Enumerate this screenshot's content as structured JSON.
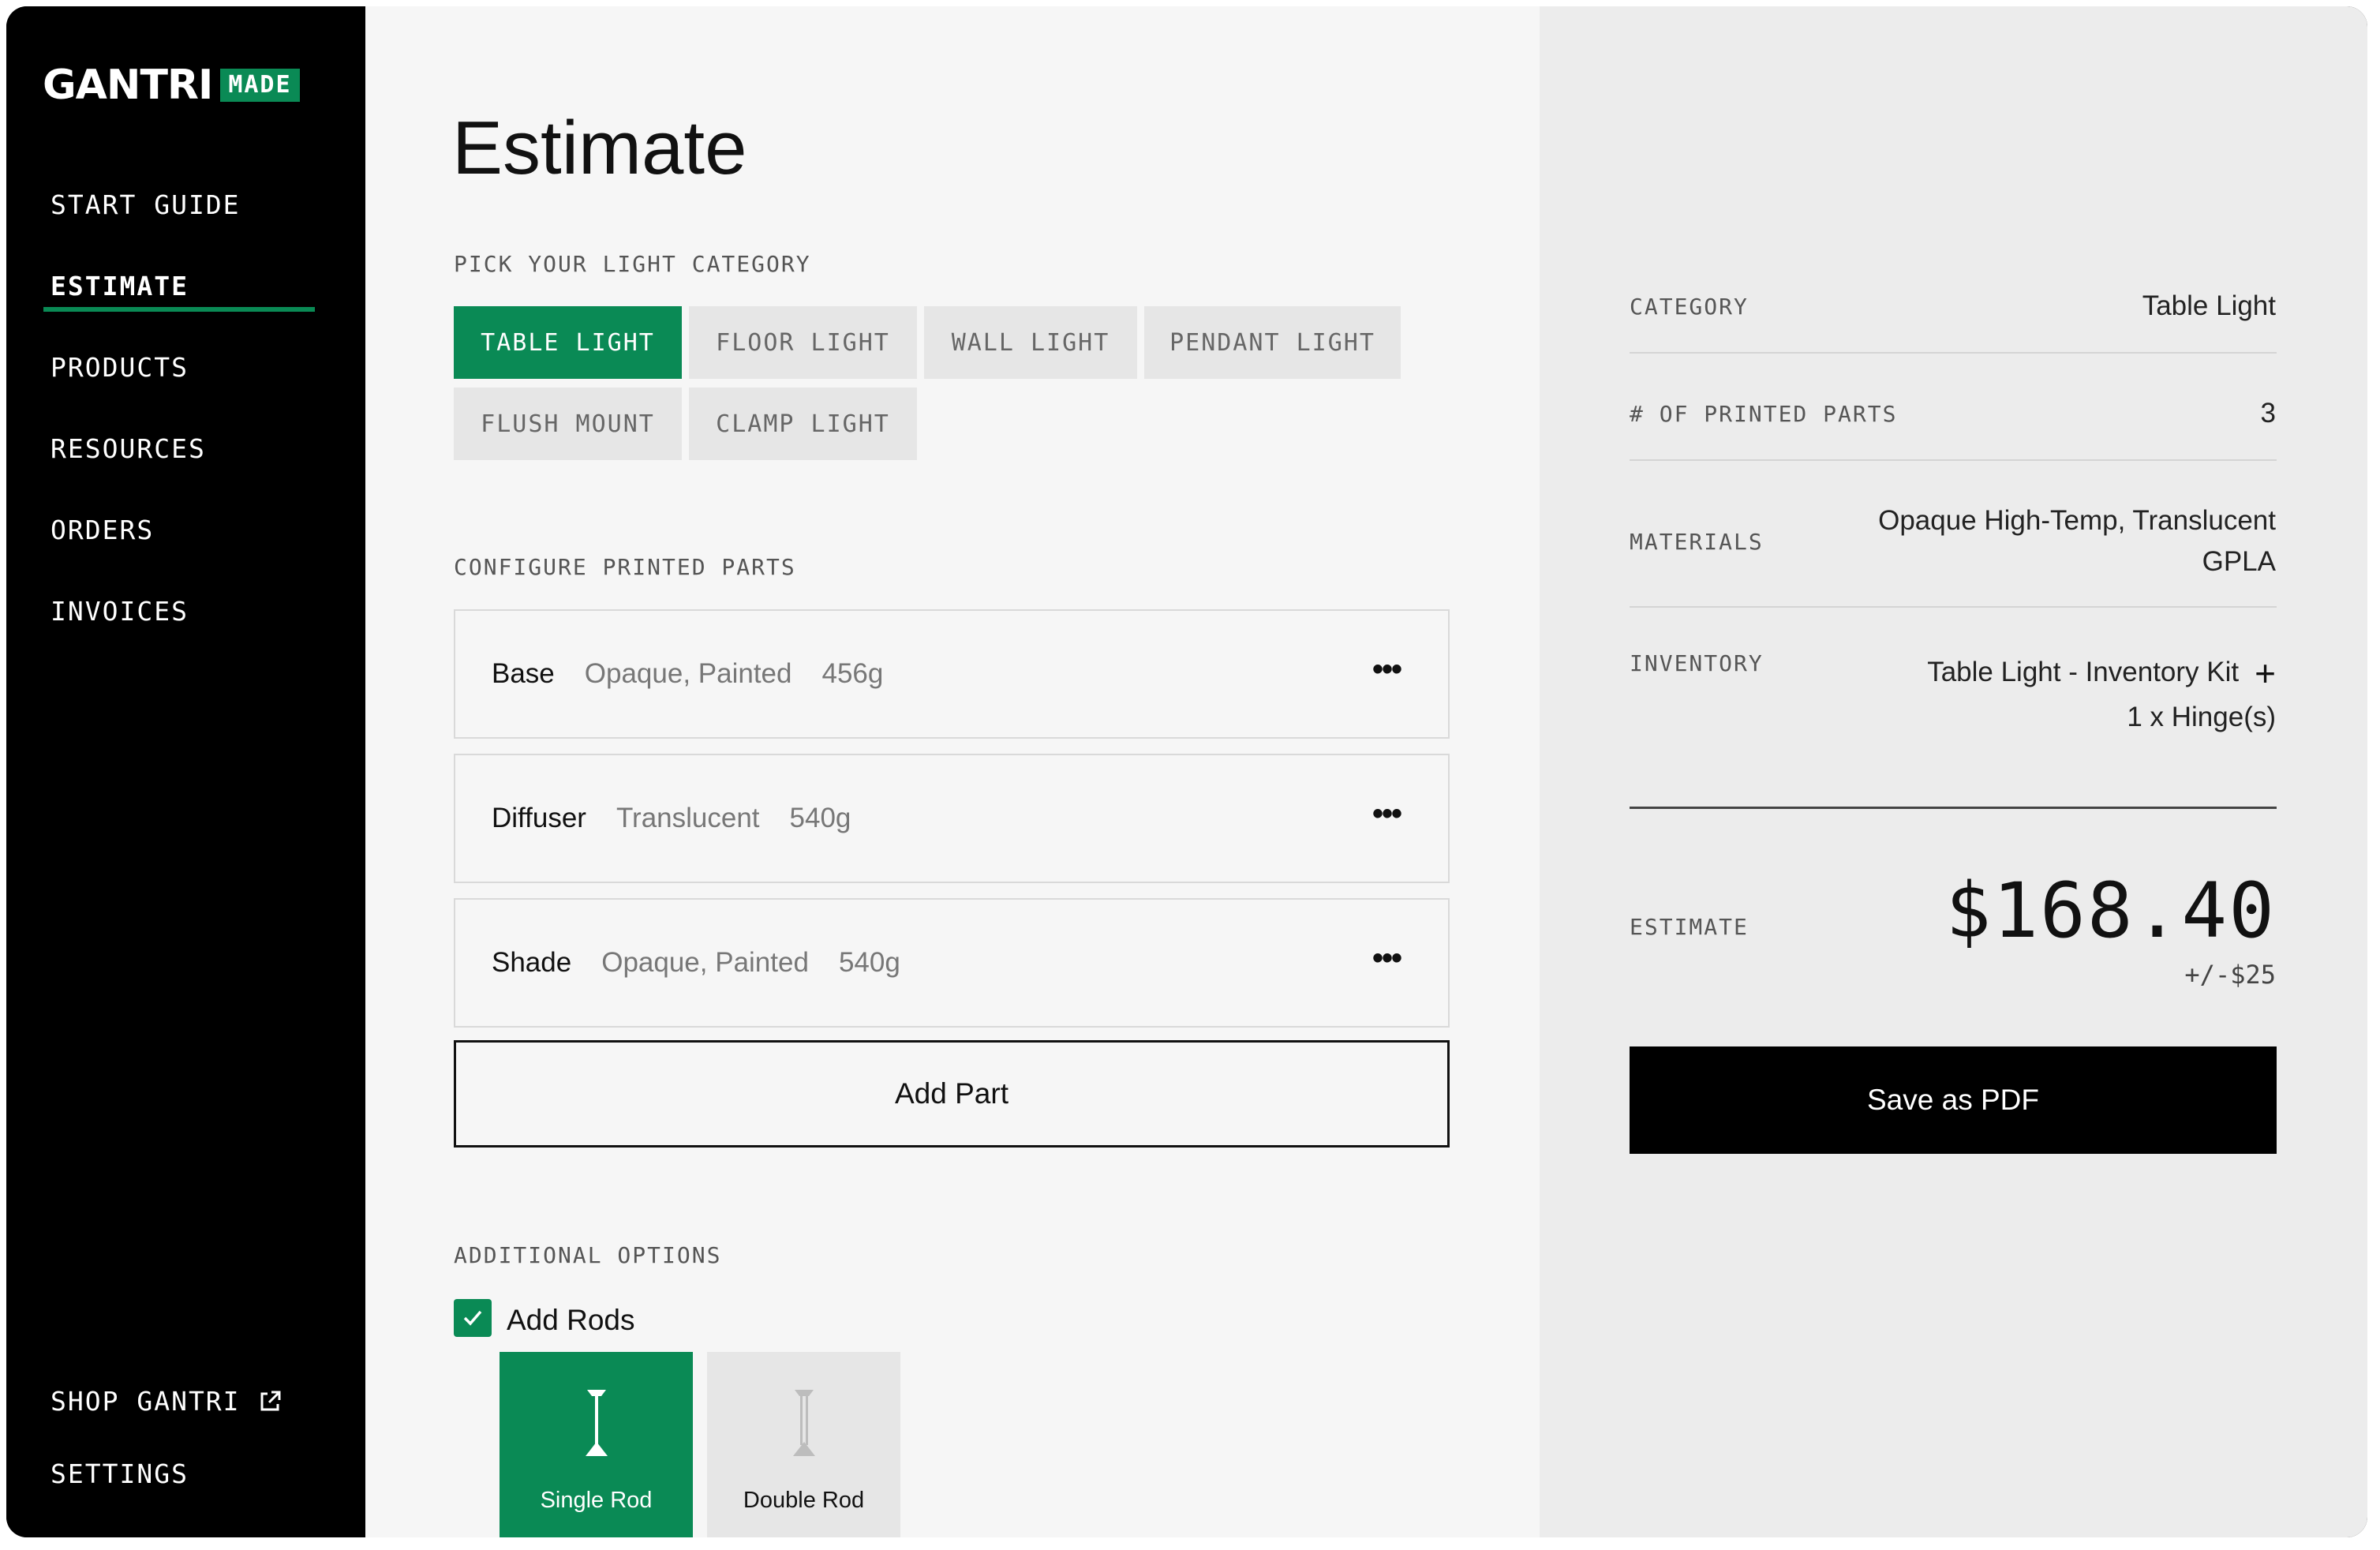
{
  "brand": {
    "wordmark": "GANTRI",
    "badge": "MADE",
    "accent": "#0a8a55"
  },
  "sidebar": {
    "items": [
      {
        "label": "START GUIDE",
        "active": false
      },
      {
        "label": "ESTIMATE",
        "active": true
      },
      {
        "label": "PRODUCTS",
        "active": false
      },
      {
        "label": "RESOURCES",
        "active": false
      },
      {
        "label": "ORDERS",
        "active": false
      },
      {
        "label": "INVOICES",
        "active": false
      }
    ],
    "bottom": [
      {
        "label": "SHOP GANTRI",
        "icon": "external-link-icon"
      },
      {
        "label": "SETTINGS"
      }
    ]
  },
  "main": {
    "title": "Estimate",
    "category_section": "PICK YOUR LIGHT CATEGORY",
    "categories": [
      {
        "label": "TABLE LIGHT",
        "selected": true
      },
      {
        "label": "FLOOR LIGHT",
        "selected": false
      },
      {
        "label": "WALL LIGHT",
        "selected": false
      },
      {
        "label": "PENDANT LIGHT",
        "selected": false
      },
      {
        "label": "FLUSH MOUNT",
        "selected": false
      },
      {
        "label": "CLAMP LIGHT",
        "selected": false
      }
    ],
    "parts_section": "CONFIGURE PRINTED PARTS",
    "parts": [
      {
        "name": "Base",
        "material": "Opaque, Painted",
        "weight": "456g"
      },
      {
        "name": "Diffuser",
        "material": "Translucent",
        "weight": "540g"
      },
      {
        "name": "Shade",
        "material": "Opaque, Painted",
        "weight": "540g"
      }
    ],
    "more_icon": "•••",
    "add_part_label": "Add Part",
    "options_section": "ADDITIONAL OPTIONS",
    "add_rods": {
      "label": "Add Rods",
      "checked": true
    },
    "rod_options": [
      {
        "label": "Single Rod",
        "selected": true
      },
      {
        "label": "Double Rod",
        "selected": false
      }
    ]
  },
  "summary": {
    "category": {
      "label": "CATEGORY",
      "value": "Table Light"
    },
    "printed_parts": {
      "label": "# OF PRINTED PARTS",
      "value": "3"
    },
    "materials": {
      "label": "MATERIALS",
      "line1": "Opaque High-Temp, Translucent",
      "line2": "GPLA"
    },
    "inventory": {
      "label": "INVENTORY",
      "line1": "Table Light - Inventory Kit",
      "line2": "1 x Hinge(s)",
      "icon": "plus-icon"
    },
    "estimate": {
      "label": "ESTIMATE",
      "price": "$168.40",
      "range": "+/-$25"
    },
    "save_label": "Save as PDF"
  }
}
